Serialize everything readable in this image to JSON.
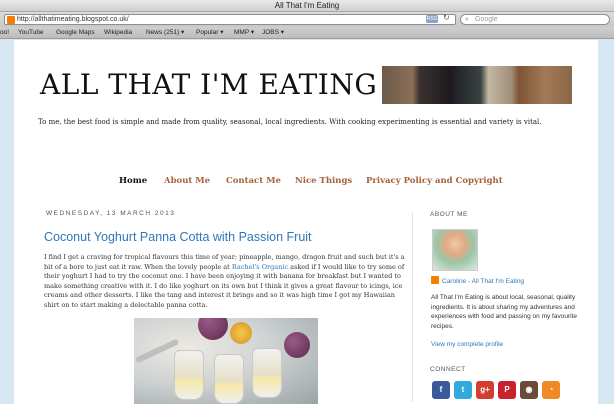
{
  "window": {
    "title": "All That I'm Eating"
  },
  "browser": {
    "url": "http://allthatimeating.blogspot.co.uk/",
    "rss_badge": "RSS",
    "search_placeholder": "Google",
    "bookmarks": [
      "oo!",
      "YouTube",
      "Google Maps",
      "Wikipedia",
      "News (251) ▾",
      "Popular ▾",
      "MMP ▾",
      "JOBS ▾"
    ]
  },
  "blog": {
    "title": "ALL THAT I'M EATING",
    "tagline": "To me, the best food is simple and made from quality, seasonal, local ingredients. With cooking experimenting is essential and variety is vital."
  },
  "nav": {
    "items": [
      "Home",
      "About Me",
      "Contact Me",
      "Nice Things",
      "Privacy Policy and Copyright"
    ]
  },
  "post": {
    "date": "WEDNESDAY, 13 MARCH 2013",
    "title": "Coconut Yoghurt Panna Cotta with Passion Fruit",
    "body_before_link": "I find I get a craving for tropical flavours this time of year; pineapple, mango, dragon fruit and such but it's a bit of a bore to just eat it raw. When the lovely people at ",
    "link_text": "Rachel's Organic",
    "body_after_link": " asked if I would like to try some of their yoghurt I had to try the coconut one. I have been enjoying it with banana for breakfast but I wanted to make something creative with it. I do like yoghurt on its own but I think it gives a great flavour to icings, ice creams and other desserts. I like the tang and interest it brings and so it was high time I got my Hawaiian shirt on to start making a delectable panna cotta."
  },
  "sidebar": {
    "about_title": "ABOUT ME",
    "profile_name": "Caroline - All That I'm Eating",
    "about_text": "All That I'm Eating is about local, seasonal, quality ingredients. It is about sharing my adventures and experiences with food and passing on my favourite recipes.",
    "profile_link": "View my complete profile",
    "connect_title": "CONNECT",
    "social_icons": [
      {
        "name": "facebook",
        "glyph": "f",
        "color": "#3b5998"
      },
      {
        "name": "twitter",
        "glyph": "t",
        "color": "#33aadd"
      },
      {
        "name": "google-plus",
        "glyph": "g+",
        "color": "#d23f31"
      },
      {
        "name": "pinterest",
        "glyph": "P",
        "color": "#c8232c"
      },
      {
        "name": "instagram",
        "glyph": "◉",
        "color": "#6b4a3a"
      },
      {
        "name": "rss",
        "glyph": "◔",
        "color": "#f08a24"
      }
    ]
  }
}
